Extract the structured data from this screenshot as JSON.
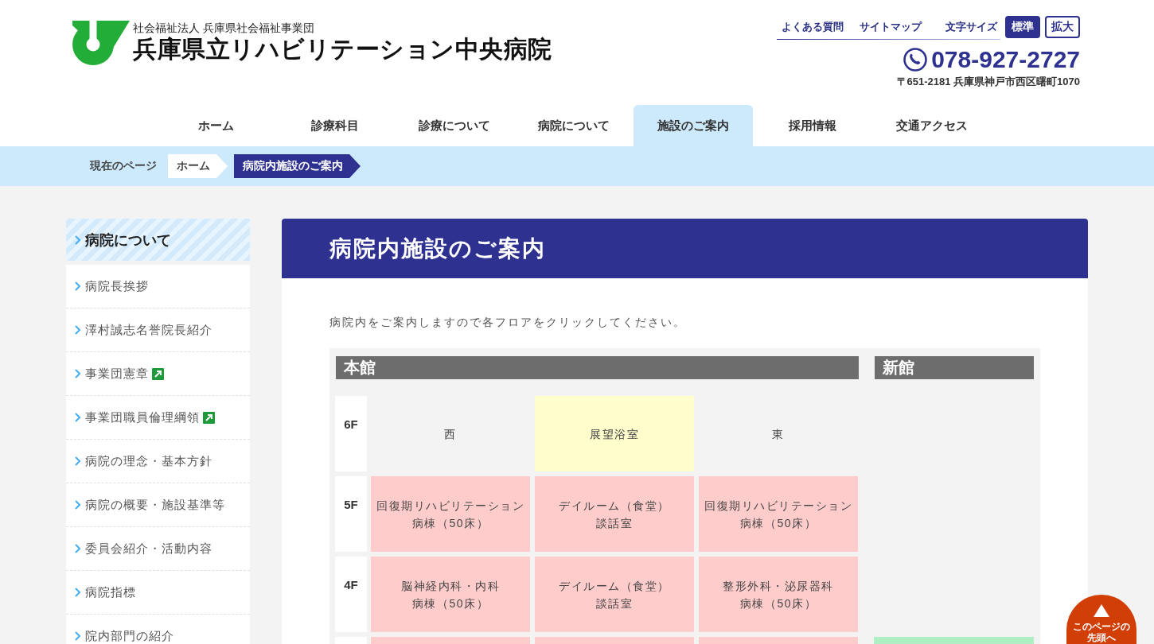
{
  "header": {
    "logo": {
      "subtitle": "社会福祉法人 兵庫県社会福祉事業団",
      "title": "兵庫県立リハビリテーション中央病院"
    },
    "links": [
      "よくある質問",
      "サイトマップ"
    ],
    "font_size": {
      "label": "文字サイズ",
      "options": [
        {
          "label": "標準",
          "selected": true
        },
        {
          "label": "拡大",
          "selected": false
        }
      ]
    },
    "phone": "078-927-2727",
    "address": "〒651-2181 兵庫県神戸市西区曙町1070"
  },
  "nav": [
    {
      "label": "ホーム",
      "selected": false
    },
    {
      "label": "診療科目",
      "selected": false
    },
    {
      "label": "診療について",
      "selected": false
    },
    {
      "label": "病院について",
      "selected": false
    },
    {
      "label": "施設のご案内",
      "selected": true
    },
    {
      "label": "採用情報",
      "selected": false
    },
    {
      "label": "交通アクセス",
      "selected": false
    }
  ],
  "breadcrumb": {
    "label": "現在のページ",
    "items": [
      {
        "label": "ホーム",
        "current": false
      },
      {
        "label": "病院内施設のご案内",
        "current": true
      }
    ]
  },
  "sidebar": {
    "title": "病院について",
    "items": [
      {
        "label": "病院長挨拶",
        "external": false
      },
      {
        "label": "澤村誠志名誉院長紹介",
        "external": false
      },
      {
        "label": "事業団憲章",
        "external": true
      },
      {
        "label": "事業団職員倫理綱領",
        "external": true
      },
      {
        "label": "病院の理念・基本方針",
        "external": false
      },
      {
        "label": "病院の概要・施設基準等",
        "external": false
      },
      {
        "label": "委員会紹介・活動内容",
        "external": false
      },
      {
        "label": "病院指標",
        "external": false
      },
      {
        "label": "院内部門の紹介",
        "external": false
      }
    ]
  },
  "main": {
    "title": "病院内施設のご案内",
    "intro": "病院内をご案内しますので各フロアをクリックしてください。",
    "floor_map": {
      "main_building": "本館",
      "annex": "新館",
      "floors": [
        {
          "floor": "6F",
          "rooms": [
            {
              "kind": "plain",
              "lines": [
                "西"
              ]
            },
            {
              "kind": "bath",
              "lines": [
                "展望浴室"
              ]
            },
            {
              "kind": "plain",
              "lines": [
                "東"
              ]
            }
          ]
        },
        {
          "floor": "5F",
          "rooms": [
            {
              "kind": "ward",
              "lines": [
                "回復期リハビリテーション",
                "病棟（50床）"
              ]
            },
            {
              "kind": "ward",
              "lines": [
                "デイルーム（食堂）",
                "談話室"
              ]
            },
            {
              "kind": "ward",
              "lines": [
                "回復期リハビリテーション",
                "病棟（50床）"
              ]
            }
          ]
        },
        {
          "floor": "4F",
          "rooms": [
            {
              "kind": "ward",
              "lines": [
                "脳神経内科・内科",
                "病棟（50床）"
              ]
            },
            {
              "kind": "ward",
              "lines": [
                "デイルーム（食堂）",
                "談話室"
              ]
            },
            {
              "kind": "ward",
              "lines": [
                "整形外科・泌尿器科",
                "病棟（50床）"
              ]
            }
          ]
        },
        {
          "rooms": [
            {
              "kind": "ward"
            },
            {
              "kind": "ward"
            },
            {
              "kind": "ward"
            }
          ],
          "annex_room": {
            "kind": "annex"
          }
        }
      ]
    }
  },
  "back_to_top": {
    "label": "このページの先頭へ"
  }
}
